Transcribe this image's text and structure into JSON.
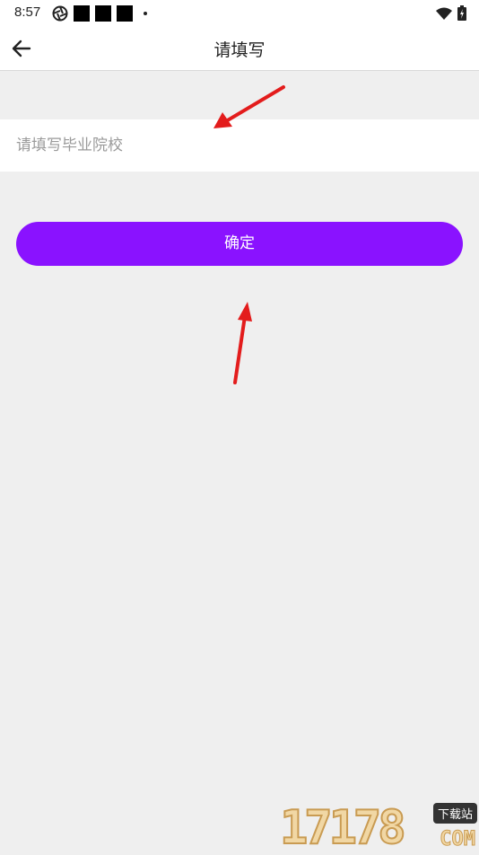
{
  "status_bar": {
    "time": "8:57"
  },
  "app_bar": {
    "title": "请填写"
  },
  "form": {
    "school_placeholder": "请填写毕业院校",
    "school_value": ""
  },
  "actions": {
    "confirm_label": "确定"
  },
  "colors": {
    "accent": "#8a12ff",
    "background": "#efefef",
    "annotation_arrow": "#e31c1c"
  },
  "watermark": {
    "digits": "17178",
    "badge": "下载站",
    "suffix": "COM"
  }
}
